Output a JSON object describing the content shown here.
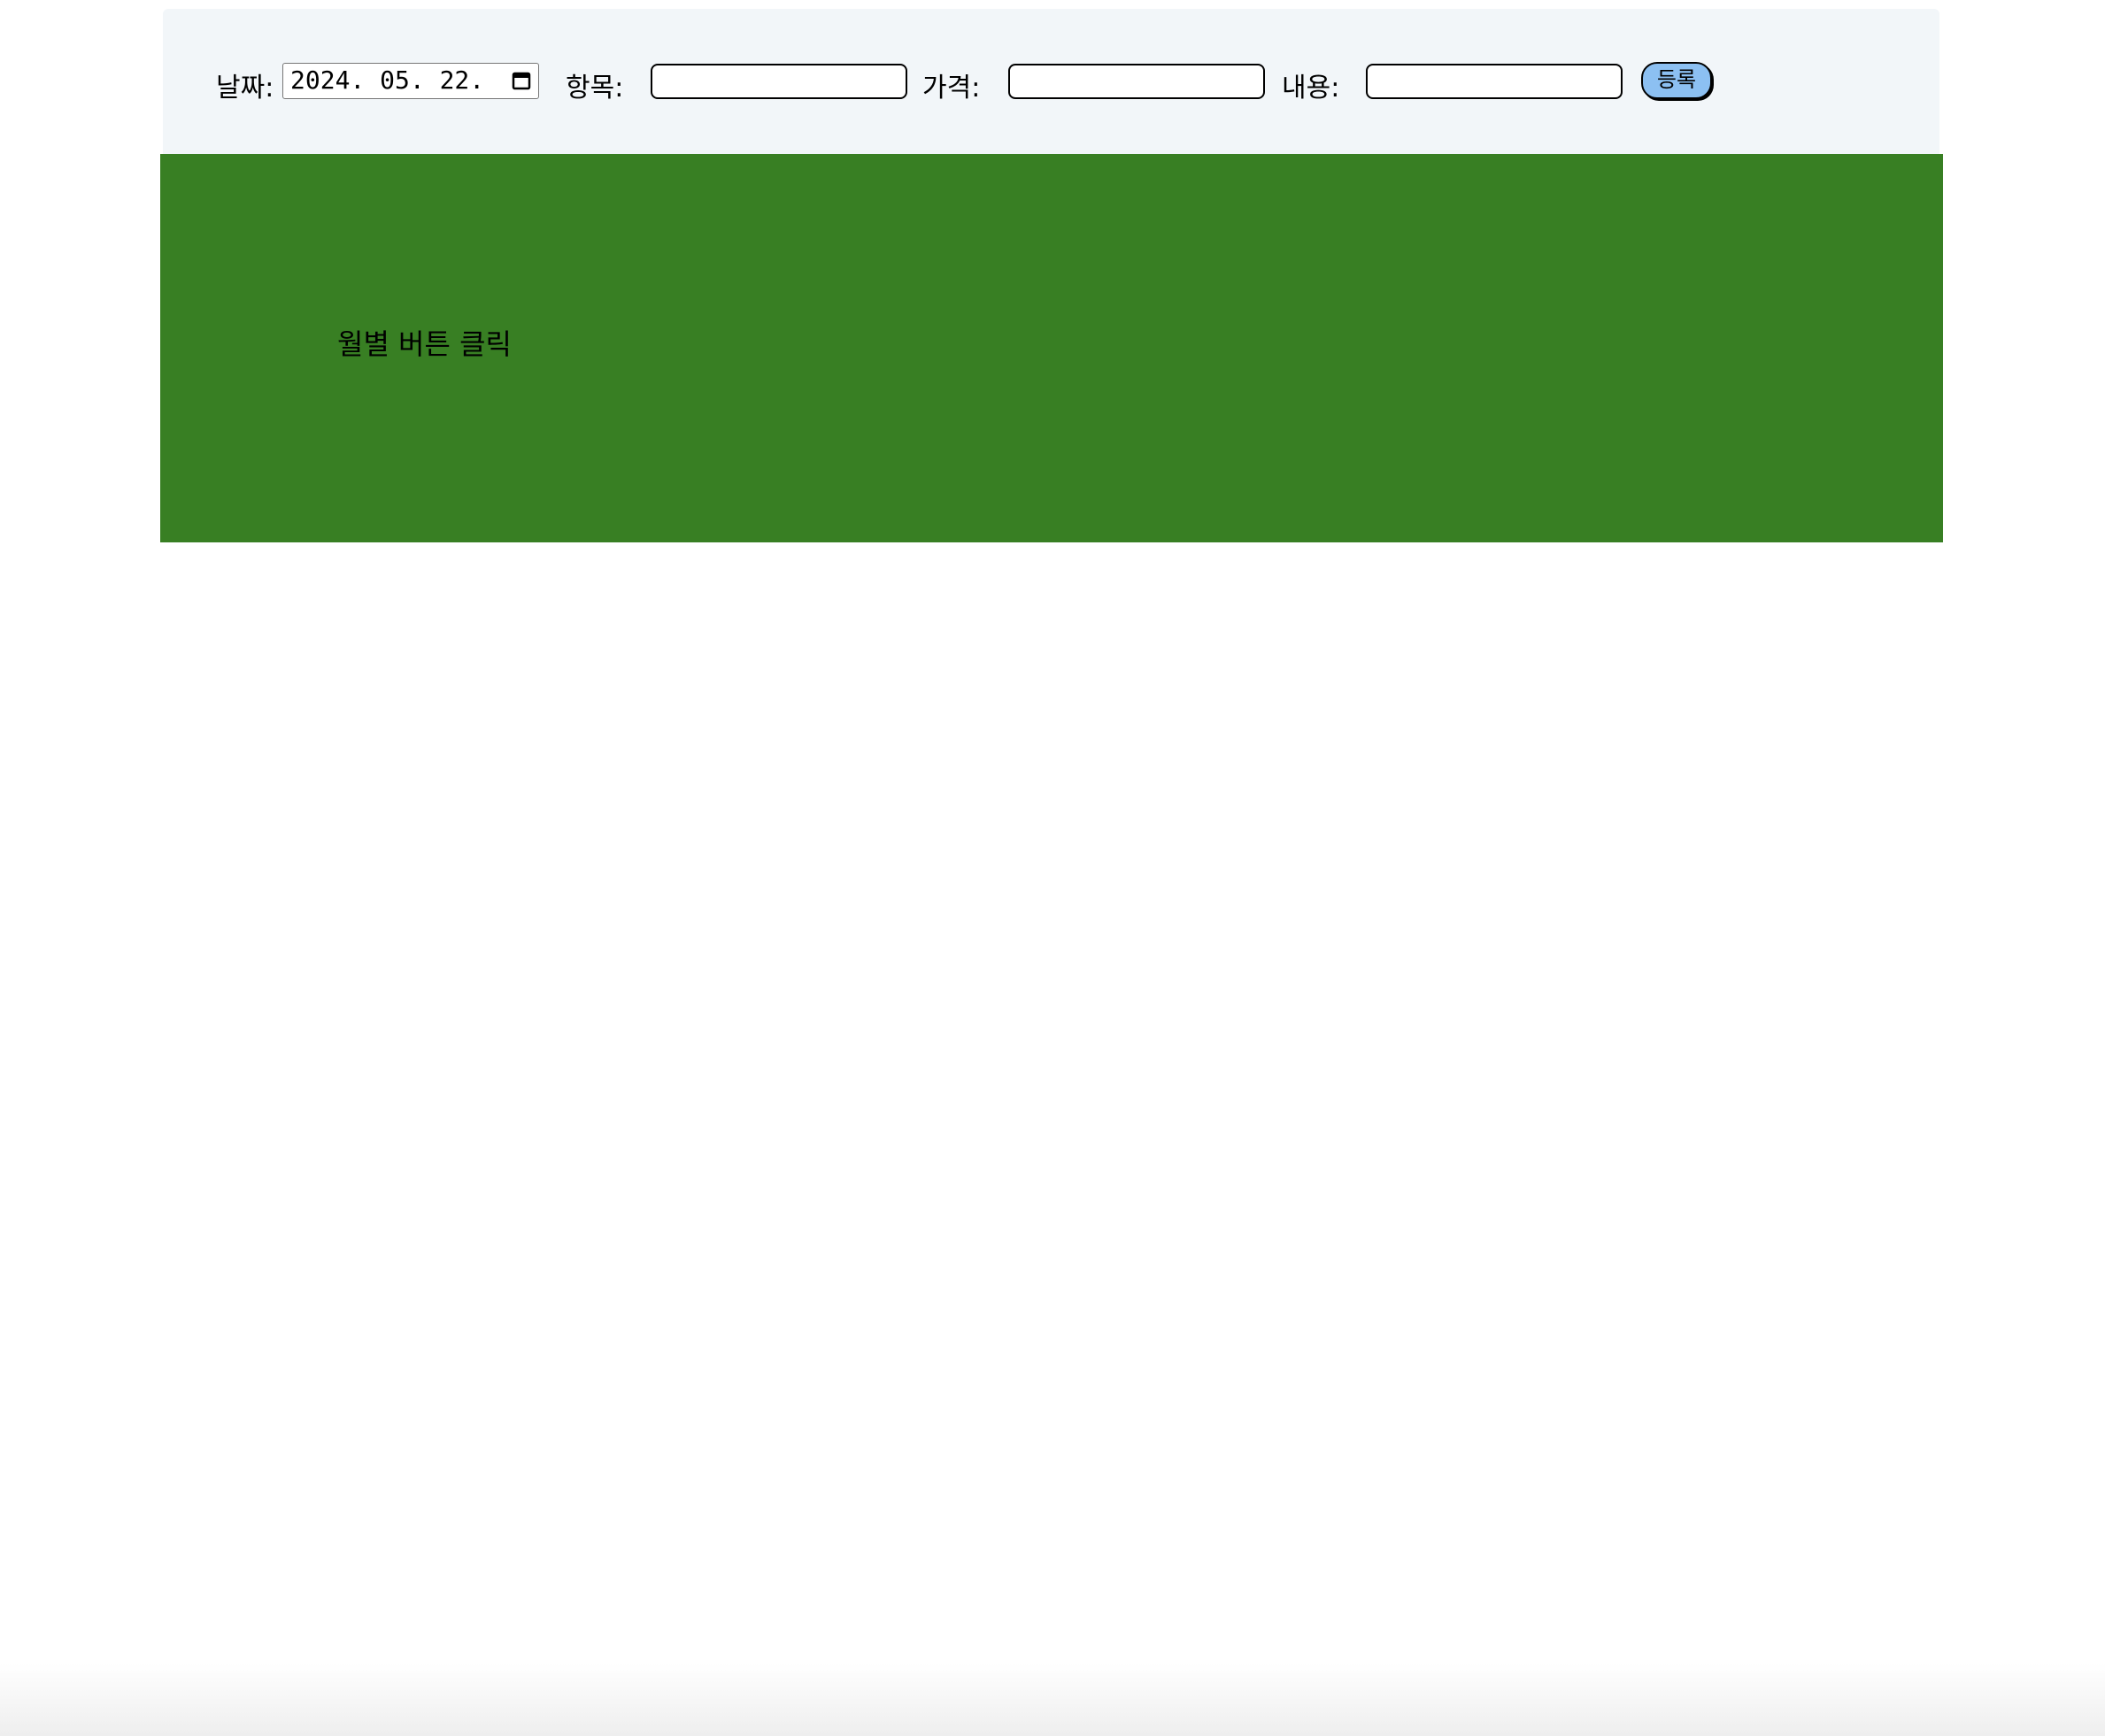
{
  "form": {
    "date_label": "날짜:",
    "date_value": "2024. 05. 22.",
    "item_label": "항목:",
    "item_value": "",
    "price_label": "가격:",
    "price_value": "",
    "content_label": "내용:",
    "content_value": "",
    "submit_label": "등록"
  },
  "panel": {
    "message": "월별 버튼 클릭"
  },
  "colors": {
    "form_background": "#f2f6f9",
    "panel_background": "#387f23",
    "button_background": "#8cc0f2"
  }
}
